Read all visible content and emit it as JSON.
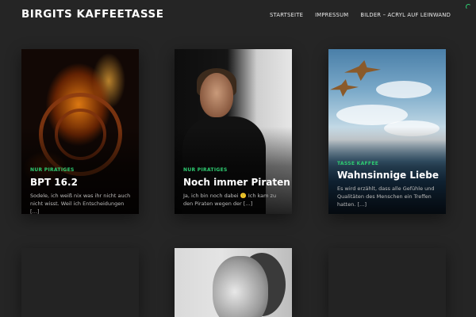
{
  "site": {
    "title": "BIRGITS KAFFEETASSE"
  },
  "nav": [
    {
      "label": "STARTSEITE"
    },
    {
      "label": "IMPRESSUM"
    },
    {
      "label": "BILDER – ACRYL AUF LEINWAND"
    }
  ],
  "posts": [
    {
      "category": "NUR PIRATIGES",
      "title": "BPT 16.2",
      "excerpt": "Sodele, ich weiß nix was ihr nicht auch nicht wisst. Weil ich Entscheidungen […]"
    },
    {
      "category": "NUR PIRATIGES",
      "title": "Noch immer Piraten",
      "excerpt": "Ja, ich bin noch dabei 🙂 Ich kam zu den Piraten wegen der […]"
    },
    {
      "category": "TASSE KAFFEE",
      "title": "Wahnsinnige Liebe",
      "excerpt": "Es wird erzählt, dass alle Gefühle und Qualitäten des Menschen ein Treffen hatten. […]"
    }
  ],
  "colors": {
    "background": "#252525",
    "accent": "#2ecc71"
  },
  "icons": {
    "loader": "loading-spinner-icon"
  }
}
